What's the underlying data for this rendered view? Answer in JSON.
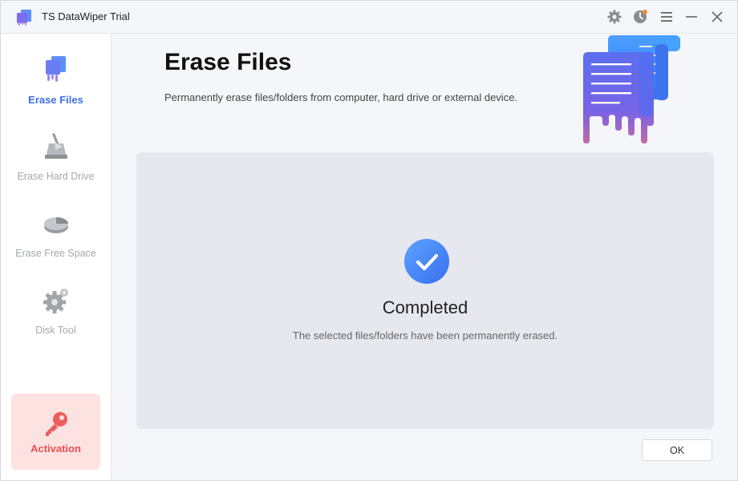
{
  "app": {
    "title": "TS DataWiper Trial"
  },
  "titlebar_icons": [
    "gear-icon",
    "history-icon",
    "menu-icon",
    "minimize-icon",
    "close-icon"
  ],
  "sidebar": {
    "items": [
      {
        "label": "Erase Files",
        "icon": "erase-files-icon",
        "active": true
      },
      {
        "label": "Erase Hard Drive",
        "icon": "hard-drive-icon",
        "active": false
      },
      {
        "label": "Erase Free Space",
        "icon": "free-space-icon",
        "active": false
      },
      {
        "label": "Disk Tool",
        "icon": "disk-tool-gear-icon",
        "active": false
      }
    ],
    "activation": {
      "label": "Activation",
      "icon": "key-icon"
    }
  },
  "main": {
    "title": "Erase Files",
    "subtitle": "Permanently erase files/folders from computer, hard drive or external device.",
    "result": {
      "title": "Completed",
      "message": "The selected files/folders have been permanently erased."
    },
    "ok_label": "OK"
  },
  "colors": {
    "accent": "#3d6fea",
    "activation_bg": "#fde2e2",
    "activation_text": "#ec4f4f",
    "panel_bg": "#e7e7ef",
    "notification_dot": "#f28a2a"
  }
}
